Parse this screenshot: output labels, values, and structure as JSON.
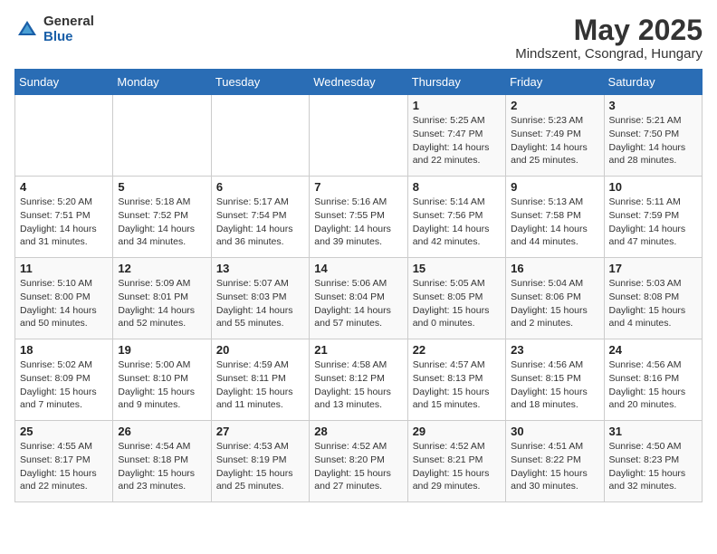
{
  "logo": {
    "general": "General",
    "blue": "Blue"
  },
  "title": "May 2025",
  "subtitle": "Mindszent, Csongrad, Hungary",
  "days": [
    "Sunday",
    "Monday",
    "Tuesday",
    "Wednesday",
    "Thursday",
    "Friday",
    "Saturday"
  ],
  "weeks": [
    [
      {
        "num": "",
        "info": ""
      },
      {
        "num": "",
        "info": ""
      },
      {
        "num": "",
        "info": ""
      },
      {
        "num": "",
        "info": ""
      },
      {
        "num": "1",
        "info": "Sunrise: 5:25 AM\nSunset: 7:47 PM\nDaylight: 14 hours\nand 22 minutes."
      },
      {
        "num": "2",
        "info": "Sunrise: 5:23 AM\nSunset: 7:49 PM\nDaylight: 14 hours\nand 25 minutes."
      },
      {
        "num": "3",
        "info": "Sunrise: 5:21 AM\nSunset: 7:50 PM\nDaylight: 14 hours\nand 28 minutes."
      }
    ],
    [
      {
        "num": "4",
        "info": "Sunrise: 5:20 AM\nSunset: 7:51 PM\nDaylight: 14 hours\nand 31 minutes."
      },
      {
        "num": "5",
        "info": "Sunrise: 5:18 AM\nSunset: 7:52 PM\nDaylight: 14 hours\nand 34 minutes."
      },
      {
        "num": "6",
        "info": "Sunrise: 5:17 AM\nSunset: 7:54 PM\nDaylight: 14 hours\nand 36 minutes."
      },
      {
        "num": "7",
        "info": "Sunrise: 5:16 AM\nSunset: 7:55 PM\nDaylight: 14 hours\nand 39 minutes."
      },
      {
        "num": "8",
        "info": "Sunrise: 5:14 AM\nSunset: 7:56 PM\nDaylight: 14 hours\nand 42 minutes."
      },
      {
        "num": "9",
        "info": "Sunrise: 5:13 AM\nSunset: 7:58 PM\nDaylight: 14 hours\nand 44 minutes."
      },
      {
        "num": "10",
        "info": "Sunrise: 5:11 AM\nSunset: 7:59 PM\nDaylight: 14 hours\nand 47 minutes."
      }
    ],
    [
      {
        "num": "11",
        "info": "Sunrise: 5:10 AM\nSunset: 8:00 PM\nDaylight: 14 hours\nand 50 minutes."
      },
      {
        "num": "12",
        "info": "Sunrise: 5:09 AM\nSunset: 8:01 PM\nDaylight: 14 hours\nand 52 minutes."
      },
      {
        "num": "13",
        "info": "Sunrise: 5:07 AM\nSunset: 8:03 PM\nDaylight: 14 hours\nand 55 minutes."
      },
      {
        "num": "14",
        "info": "Sunrise: 5:06 AM\nSunset: 8:04 PM\nDaylight: 14 hours\nand 57 minutes."
      },
      {
        "num": "15",
        "info": "Sunrise: 5:05 AM\nSunset: 8:05 PM\nDaylight: 15 hours\nand 0 minutes."
      },
      {
        "num": "16",
        "info": "Sunrise: 5:04 AM\nSunset: 8:06 PM\nDaylight: 15 hours\nand 2 minutes."
      },
      {
        "num": "17",
        "info": "Sunrise: 5:03 AM\nSunset: 8:08 PM\nDaylight: 15 hours\nand 4 minutes."
      }
    ],
    [
      {
        "num": "18",
        "info": "Sunrise: 5:02 AM\nSunset: 8:09 PM\nDaylight: 15 hours\nand 7 minutes."
      },
      {
        "num": "19",
        "info": "Sunrise: 5:00 AM\nSunset: 8:10 PM\nDaylight: 15 hours\nand 9 minutes."
      },
      {
        "num": "20",
        "info": "Sunrise: 4:59 AM\nSunset: 8:11 PM\nDaylight: 15 hours\nand 11 minutes."
      },
      {
        "num": "21",
        "info": "Sunrise: 4:58 AM\nSunset: 8:12 PM\nDaylight: 15 hours\nand 13 minutes."
      },
      {
        "num": "22",
        "info": "Sunrise: 4:57 AM\nSunset: 8:13 PM\nDaylight: 15 hours\nand 15 minutes."
      },
      {
        "num": "23",
        "info": "Sunrise: 4:56 AM\nSunset: 8:15 PM\nDaylight: 15 hours\nand 18 minutes."
      },
      {
        "num": "24",
        "info": "Sunrise: 4:56 AM\nSunset: 8:16 PM\nDaylight: 15 hours\nand 20 minutes."
      }
    ],
    [
      {
        "num": "25",
        "info": "Sunrise: 4:55 AM\nSunset: 8:17 PM\nDaylight: 15 hours\nand 22 minutes."
      },
      {
        "num": "26",
        "info": "Sunrise: 4:54 AM\nSunset: 8:18 PM\nDaylight: 15 hours\nand 23 minutes."
      },
      {
        "num": "27",
        "info": "Sunrise: 4:53 AM\nSunset: 8:19 PM\nDaylight: 15 hours\nand 25 minutes."
      },
      {
        "num": "28",
        "info": "Sunrise: 4:52 AM\nSunset: 8:20 PM\nDaylight: 15 hours\nand 27 minutes."
      },
      {
        "num": "29",
        "info": "Sunrise: 4:52 AM\nSunset: 8:21 PM\nDaylight: 15 hours\nand 29 minutes."
      },
      {
        "num": "30",
        "info": "Sunrise: 4:51 AM\nSunset: 8:22 PM\nDaylight: 15 hours\nand 30 minutes."
      },
      {
        "num": "31",
        "info": "Sunrise: 4:50 AM\nSunset: 8:23 PM\nDaylight: 15 hours\nand 32 minutes."
      }
    ]
  ]
}
